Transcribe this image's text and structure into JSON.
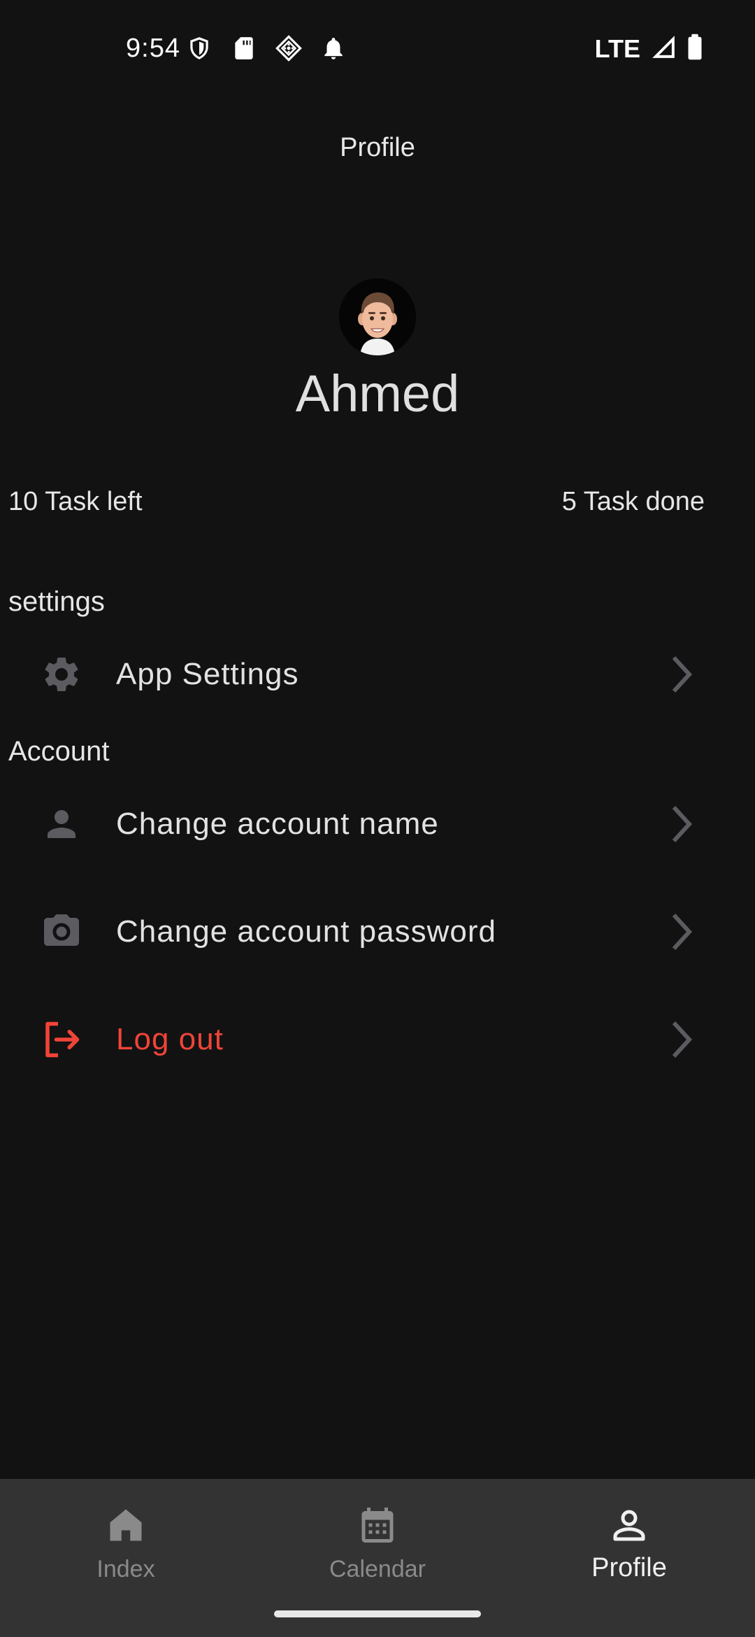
{
  "status_bar": {
    "time": "9:54",
    "network": "LTE",
    "icons": [
      "shield-icon",
      "sd-card-icon",
      "cast-icon",
      "bell-icon",
      "signal-icon",
      "battery-icon"
    ]
  },
  "app_bar": {
    "title": "Profile"
  },
  "profile": {
    "name": "Ahmed",
    "avatar": "memoji-avatar"
  },
  "stats": {
    "left": "10 Task left",
    "right": "5 Task done"
  },
  "sections": {
    "settings": {
      "label": "settings",
      "items": [
        {
          "label": "App Settings",
          "icon": "gear-icon"
        }
      ]
    },
    "account": {
      "label": "Account",
      "items": [
        {
          "label": "Change account name",
          "icon": "person-icon"
        },
        {
          "label": "Change account password",
          "icon": "camera-icon"
        },
        {
          "label": "Log out",
          "icon": "logout-icon"
        }
      ]
    }
  },
  "bottom_nav": {
    "items": [
      {
        "label": "Index",
        "icon": "home-icon",
        "active": false
      },
      {
        "label": "Calendar",
        "icon": "calendar-icon",
        "active": false
      },
      {
        "label": "Profile",
        "icon": "person-outline-icon",
        "active": true
      }
    ]
  },
  "colors": {
    "background": "#121212",
    "nav_background": "#333333",
    "danger": "#f04438",
    "icon_muted": "#5b5b60"
  }
}
